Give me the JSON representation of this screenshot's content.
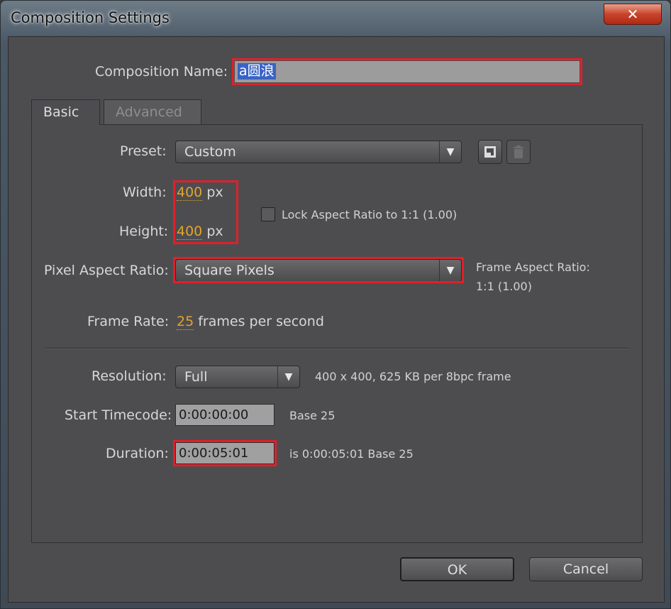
{
  "window": {
    "title": "Composition Settings",
    "close_glyph": "✕"
  },
  "composition_name": {
    "label": "Composition Name:",
    "value": "a圆浪"
  },
  "tabs": [
    {
      "label": "Basic",
      "active": true
    },
    {
      "label": "Advanced",
      "active": false
    }
  ],
  "preset": {
    "label": "Preset:",
    "value": "Custom",
    "icons": [
      "save-preset-icon",
      "delete-preset-icon"
    ]
  },
  "width": {
    "label": "Width:",
    "value": "400",
    "unit": "px"
  },
  "height": {
    "label": "Height:",
    "value": "400",
    "unit": "px"
  },
  "lock_aspect": {
    "label": "Lock Aspect Ratio to 1:1 (1.00)",
    "checked": false
  },
  "pixel_aspect": {
    "label": "Pixel Aspect Ratio:",
    "value": "Square Pixels"
  },
  "frame_aspect": {
    "label": "Frame Aspect Ratio:",
    "value": "1:1 (1.00)"
  },
  "frame_rate": {
    "label": "Frame Rate:",
    "value": "25",
    "unit": "frames per second"
  },
  "resolution": {
    "label": "Resolution:",
    "value": "Full",
    "info": "400 x 400, 625 KB per 8bpc frame"
  },
  "start_timecode": {
    "label": "Start Timecode:",
    "value": "0:00:00:00",
    "info": "Base 25"
  },
  "duration": {
    "label": "Duration:",
    "value": "0:00:05:01",
    "info": "is 0:00:05:01  Base 25"
  },
  "buttons": {
    "ok": "OK",
    "cancel": "Cancel"
  },
  "colors": {
    "highlight": "#e0202a",
    "number": "#e2a429",
    "selection": "#3a63c4"
  }
}
